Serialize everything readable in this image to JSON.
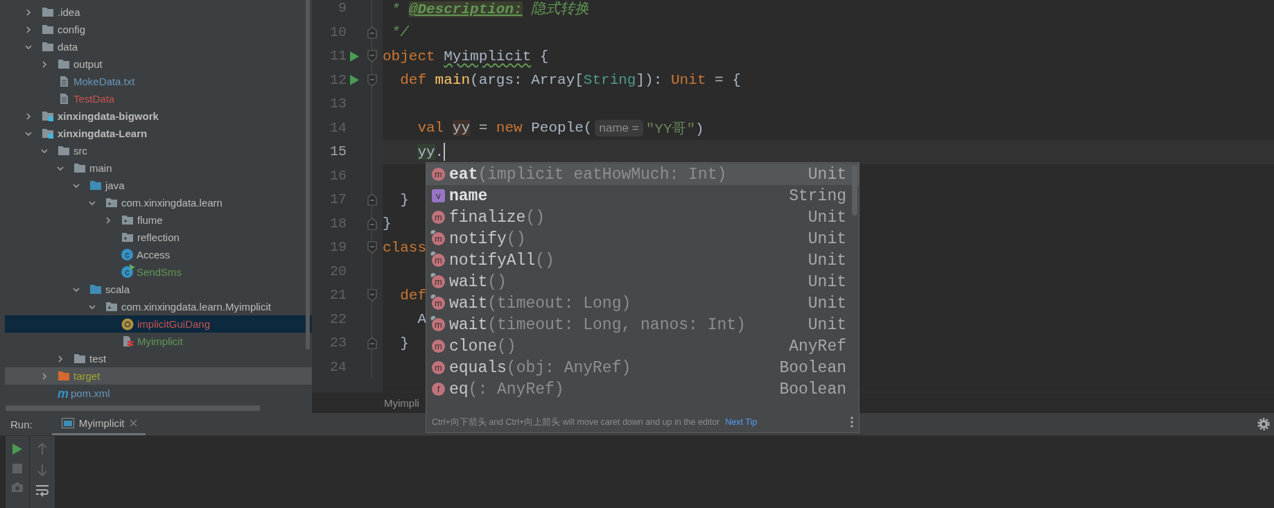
{
  "project_tree": [
    {
      "label": ".idea",
      "kind": "folder",
      "color": "#bbbbbb",
      "expanded": false,
      "selected": false,
      "shaded": false
    },
    {
      "label": "config",
      "kind": "folder",
      "color": "#bbbbbb",
      "expanded": false,
      "selected": false,
      "shaded": false
    },
    {
      "label": "data",
      "kind": "folder",
      "color": "#bbbbbb",
      "expanded": true,
      "selected": false,
      "shaded": false,
      "children": [
        {
          "label": "output",
          "kind": "folder",
          "color": "#bbbbbb",
          "expanded": false,
          "selected": false,
          "shaded": false
        },
        {
          "label": "MokeData.txt",
          "kind": "text-file",
          "color": "#6897bb",
          "selected": false,
          "shaded": false
        },
        {
          "label": "TestData",
          "kind": "text-file",
          "color": "#c75450",
          "selected": false,
          "shaded": false
        }
      ]
    },
    {
      "label": "xinxingdata-bigwork",
      "kind": "module",
      "color": "#bbbbbb",
      "expanded": false,
      "selected": false,
      "shaded": false
    },
    {
      "label": "xinxingdata-Learn",
      "kind": "module",
      "color": "#bbbbbb",
      "expanded": true,
      "selected": false,
      "shaded": false,
      "children": [
        {
          "label": "src",
          "kind": "folder",
          "color": "#bbbbbb",
          "expanded": true,
          "selected": false,
          "shaded": false,
          "children": [
            {
              "label": "main",
              "kind": "folder",
              "color": "#bbbbbb",
              "expanded": true,
              "selected": false,
              "shaded": false,
              "children": [
                {
                  "label": "java",
                  "kind": "source-folder",
                  "color": "#bbbbbb",
                  "expanded": true,
                  "selected": false,
                  "shaded": false,
                  "children": [
                    {
                      "label": "com.xinxingdata.learn",
                      "kind": "package",
                      "color": "#bbbbbb",
                      "expanded": true,
                      "selected": false,
                      "shaded": false,
                      "children": [
                        {
                          "label": "flume",
                          "kind": "package",
                          "color": "#bbbbbb",
                          "expanded": false,
                          "selected": false,
                          "shaded": false
                        },
                        {
                          "label": "reflection",
                          "kind": "package",
                          "color": "#bbbbbb",
                          "selected": false,
                          "shaded": false
                        },
                        {
                          "label": "Access",
                          "kind": "class",
                          "badge": "c",
                          "color": "#bbbbbb",
                          "selected": false,
                          "shaded": false
                        },
                        {
                          "label": "SendSms",
                          "kind": "runnable-class",
                          "badge": "c",
                          "color": "#629755",
                          "selected": false,
                          "shaded": false
                        }
                      ]
                    }
                  ]
                },
                {
                  "label": "scala",
                  "kind": "source-folder",
                  "color": "#bbbbbb",
                  "expanded": true,
                  "selected": false,
                  "shaded": false,
                  "children": [
                    {
                      "label": "com.xinxingdata.learn.Myimplicit",
                      "kind": "package",
                      "color": "#bbbbbb",
                      "expanded": true,
                      "selected": false,
                      "shaded": false,
                      "children": [
                        {
                          "label": "implicitGuiDang",
                          "kind": "object",
                          "color": "#c75450",
                          "selected": true,
                          "shaded": false
                        },
                        {
                          "label": "Myimplicit",
                          "kind": "scala-file",
                          "color": "#629755",
                          "selected": false,
                          "shaded": false
                        }
                      ]
                    }
                  ]
                }
              ]
            },
            {
              "label": "test",
              "kind": "folder",
              "color": "#bbbbbb",
              "expanded": false,
              "selected": false,
              "shaded": false
            }
          ]
        },
        {
          "label": "target",
          "kind": "excluded-folder",
          "color": "#a5a532",
          "expanded": false,
          "selected": false,
          "shaded": true
        },
        {
          "label": "pom.xml",
          "kind": "maven",
          "badge": "m",
          "color": "#6897bb",
          "selected": false,
          "shaded": false
        }
      ]
    }
  ],
  "editor": {
    "lines": [
      {
        "number": "9",
        "kind": "plain",
        "run": false,
        "current": false,
        "tokens": [
          {
            "kind": "comment",
            "text": "* "
          },
          {
            "kind": "doc-tag",
            "text": "@Description:"
          },
          {
            "kind": "comment",
            "text": " 隐式转换"
          }
        ]
      },
      {
        "number": "10",
        "kind": "fold-end",
        "run": false,
        "current": false,
        "tokens": [
          {
            "kind": "comment",
            "text": "*/"
          }
        ]
      },
      {
        "number": "11",
        "kind": "fold-start",
        "run": true,
        "current": false,
        "tokens": [
          {
            "kind": "keyword",
            "text": "object "
          },
          {
            "kind": "warn",
            "text": "Myimplicit"
          },
          {
            "kind": "plain",
            "text": " {"
          }
        ]
      },
      {
        "number": "12",
        "kind": "fold-start",
        "run": true,
        "current": false,
        "tokens": [
          {
            "kind": "keyword",
            "text": "def "
          },
          {
            "kind": "function",
            "text": "main"
          },
          {
            "kind": "plain",
            "text": "(args: Array["
          },
          {
            "kind": "type",
            "text": "String"
          },
          {
            "kind": "plain",
            "text": "]): "
          },
          {
            "kind": "keyword",
            "text": "Unit"
          },
          {
            "kind": "plain",
            "text": " = {"
          }
        ]
      },
      {
        "number": "13",
        "kind": "plain",
        "run": false,
        "current": false
      },
      {
        "number": "14",
        "kind": "plain",
        "run": false,
        "current": false,
        "tokens": [
          {
            "kind": "keyword",
            "text": "val "
          },
          {
            "kind": "usage-write",
            "text": "yy"
          },
          {
            "kind": "plain",
            "text": " = "
          },
          {
            "kind": "keyword",
            "text": "new"
          },
          {
            "kind": "plain",
            "text": " People("
          },
          {
            "kind": "hint",
            "text": "name ="
          },
          {
            "kind": "string",
            "text": "\"YY哥\""
          },
          {
            "kind": "plain",
            "text": ")"
          }
        ]
      },
      {
        "number": "15",
        "kind": "plain",
        "run": false,
        "current": true,
        "tokens": [
          {
            "kind": "usage-read",
            "text": "yy"
          },
          {
            "kind": "plain",
            "text": "."
          }
        ]
      },
      {
        "number": "16",
        "kind": "plain",
        "run": false,
        "current": false
      },
      {
        "number": "17",
        "kind": "fold-end",
        "run": false,
        "current": false,
        "tokens": [
          {
            "kind": "plain",
            "text": "}"
          }
        ]
      },
      {
        "number": "18",
        "kind": "fold-end",
        "run": false,
        "current": false,
        "tokens": [
          {
            "kind": "plain",
            "text": "}"
          }
        ]
      },
      {
        "number": "19",
        "kind": "fold-start",
        "run": false,
        "current": false,
        "tokens": [
          {
            "kind": "keyword",
            "text": "class"
          }
        ]
      },
      {
        "number": "20",
        "kind": "plain",
        "run": false,
        "current": false
      },
      {
        "number": "21",
        "kind": "fold-start",
        "run": false,
        "current": false,
        "tokens": [
          {
            "kind": "keyword",
            "text": "def"
          }
        ]
      },
      {
        "number": "22",
        "kind": "plain",
        "run": false,
        "current": false,
        "tokens": [
          {
            "kind": "plain",
            "text": "A"
          }
        ]
      },
      {
        "number": "23",
        "kind": "fold-end",
        "run": false,
        "current": false,
        "tokens": [
          {
            "kind": "plain",
            "text": "}"
          }
        ]
      },
      {
        "number": "24",
        "kind": "plain",
        "run": false,
        "current": false
      }
    ],
    "breadcrumb": "Myimpli"
  },
  "completion": {
    "items": [
      {
        "kind": "method",
        "badge": "m",
        "name": "eat",
        "params": "(implicit eatHowMuch: Int)",
        "type": "Unit",
        "bold": true,
        "inherited": false,
        "selected": true
      },
      {
        "kind": "value",
        "badge": "v",
        "name": "name",
        "type": "String",
        "bold": true,
        "inherited": false,
        "selected": false
      },
      {
        "kind": "method",
        "badge": "m",
        "name": "finalize",
        "params": "()",
        "type": "Unit",
        "bold": false,
        "inherited": false,
        "selected": false
      },
      {
        "kind": "method",
        "badge": "m",
        "name": "notify",
        "params": "()",
        "type": "Unit",
        "bold": false,
        "inherited": true,
        "selected": false
      },
      {
        "kind": "method",
        "badge": "m",
        "name": "notifyAll",
        "params": "()",
        "type": "Unit",
        "bold": false,
        "inherited": true,
        "selected": false
      },
      {
        "kind": "method",
        "badge": "m",
        "name": "wait",
        "params": "()",
        "type": "Unit",
        "bold": false,
        "inherited": true,
        "selected": false
      },
      {
        "kind": "method",
        "badge": "m",
        "name": "wait",
        "params": "(timeout: Long)",
        "type": "Unit",
        "bold": false,
        "inherited": true,
        "selected": false
      },
      {
        "kind": "method",
        "badge": "m",
        "name": "wait",
        "params": "(timeout: Long, nanos: Int)",
        "type": "Unit",
        "bold": false,
        "inherited": true,
        "selected": false
      },
      {
        "kind": "method",
        "badge": "m",
        "name": "clone",
        "params": "()",
        "type": "AnyRef",
        "bold": false,
        "inherited": false,
        "selected": false
      },
      {
        "kind": "method",
        "badge": "m",
        "name": "equals",
        "params": "(obj: AnyRef)",
        "type": "Boolean",
        "bold": false,
        "inherited": false,
        "selected": false
      },
      {
        "kind": "function",
        "badge": "f",
        "name": "eq",
        "params": "(: AnyRef)",
        "type": "Boolean",
        "bold": false,
        "inherited": false,
        "selected": false
      }
    ],
    "hint": "Ctrl+向下箭头 and Ctrl+向上箭头 will move caret down and up in the editor",
    "next_tip": "Next Tip"
  },
  "run_panel": {
    "label": "Run:",
    "tabs": [
      {
        "title": "Myimplicit",
        "selected": true
      }
    ]
  }
}
